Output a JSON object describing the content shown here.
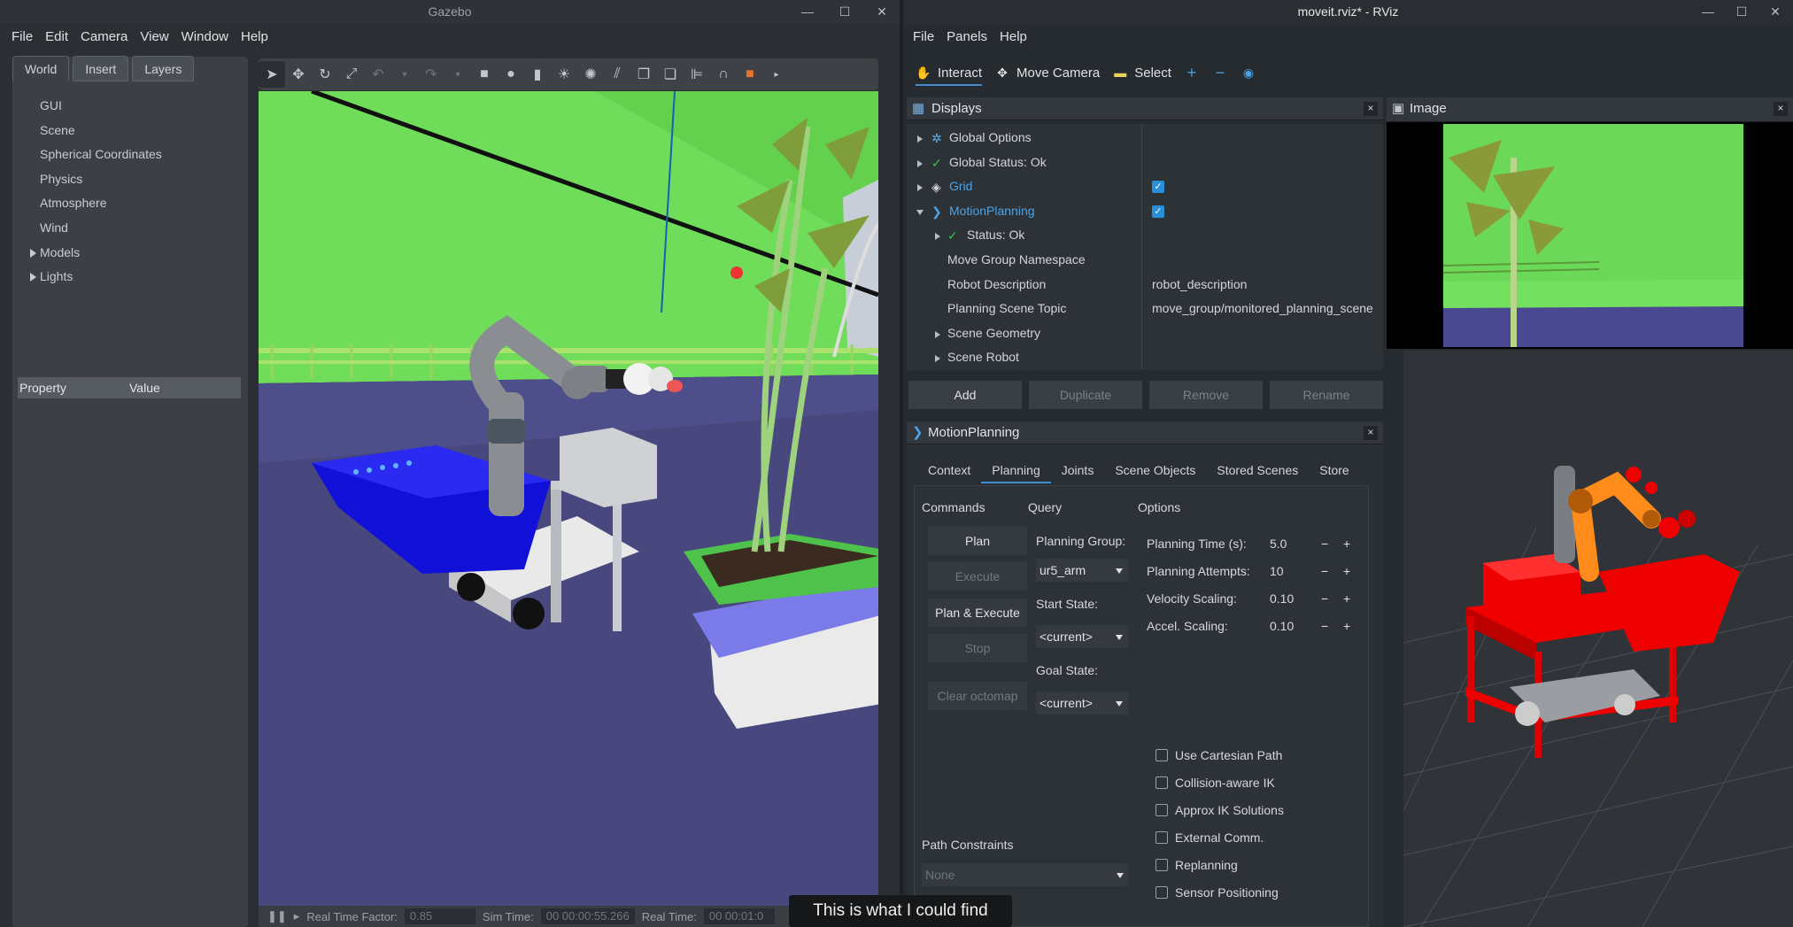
{
  "gazebo": {
    "title": "Gazebo",
    "menu": [
      "File",
      "Edit",
      "Camera",
      "View",
      "Window",
      "Help"
    ],
    "tabs": [
      "World",
      "Insert",
      "Layers"
    ],
    "tree": [
      "GUI",
      "Scene",
      "Spherical Coordinates",
      "Physics",
      "Atmosphere",
      "Wind",
      "Models",
      "Lights"
    ],
    "prop_header": {
      "property": "Property",
      "value": "Value"
    },
    "toolbar_icons": [
      "select-arrow-icon",
      "translate-icon",
      "rotate-icon",
      "scale-icon",
      "undo-icon",
      "undo-dropdown-icon",
      "redo-icon",
      "redo-dropdown-icon",
      "box-icon",
      "sphere-icon",
      "cylinder-icon",
      "point-light-icon",
      "spot-light-icon",
      "directional-light-icon",
      "copy-icon",
      "paste-icon",
      "align-icon",
      "snap-icon",
      "orange-box-icon",
      "more-icon"
    ],
    "status": {
      "real_time_factor_label": "Real Time Factor:",
      "real_time_factor": "0.85",
      "sim_time_label": "Sim Time:",
      "sim_time": "00 00:00:55.266",
      "real_time_label": "Real Time:",
      "real_time": "00 00:01:0"
    }
  },
  "rviz": {
    "title": "moveit.rviz* - RViz",
    "menu": [
      "File",
      "Panels",
      "Help"
    ],
    "toolbar": {
      "interact": "Interact",
      "move_camera": "Move Camera",
      "select": "Select"
    },
    "displays": {
      "header": "Displays",
      "rows": [
        {
          "label": "Global Options"
        },
        {
          "label": "Global Status: Ok"
        },
        {
          "label": "Grid",
          "checked": true
        },
        {
          "label": "MotionPlanning",
          "checked": true
        },
        {
          "label": "Status: Ok"
        },
        {
          "label": "Move Group Namespace",
          "value": ""
        },
        {
          "label": "Robot Description",
          "value": "robot_description"
        },
        {
          "label": "Planning Scene Topic",
          "value": "move_group/monitored_planning_scene"
        },
        {
          "label": "Scene Geometry"
        },
        {
          "label": "Scene Robot"
        }
      ],
      "buttons": [
        "Add",
        "Duplicate",
        "Remove",
        "Rename"
      ]
    },
    "image_panel": {
      "header": "Image"
    },
    "motion_planning": {
      "header": "MotionPlanning",
      "tabs": [
        "Context",
        "Planning",
        "Joints",
        "Scene Objects",
        "Stored Scenes",
        "Store"
      ],
      "commands_label": "Commands",
      "query_label": "Query",
      "options_label": "Options",
      "commands": [
        "Plan",
        "Execute",
        "Plan & Execute",
        "Stop",
        "Clear octomap"
      ],
      "planning_group_label": "Planning Group:",
      "planning_group": "ur5_arm",
      "start_state_label": "Start State:",
      "start_state": "<current>",
      "goal_state_label": "Goal State:",
      "goal_state": "<current>",
      "options": [
        {
          "label": "Planning Time (s):",
          "value": "5.0"
        },
        {
          "label": "Planning Attempts:",
          "value": "10"
        },
        {
          "label": "Velocity Scaling:",
          "value": "0.10"
        },
        {
          "label": "Accel. Scaling:",
          "value": "0.10"
        }
      ],
      "checkboxes": [
        "Use Cartesian Path",
        "Collision-aware IK",
        "Approx IK Solutions",
        "External Comm.",
        "Replanning",
        "Sensor Positioning"
      ],
      "path_constraints_label": "Path Constraints",
      "path_constraints": "None"
    }
  },
  "caption": "This is what I could find"
}
